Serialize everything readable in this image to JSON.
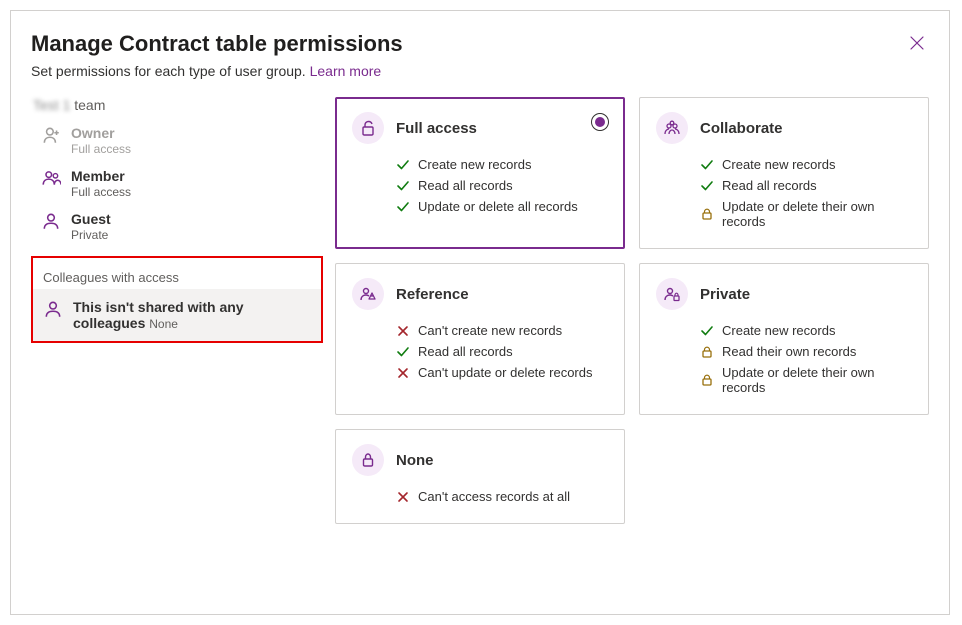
{
  "header": {
    "title": "Manage Contract table permissions",
    "subtitle_prefix": "Set permissions for each type of user group. ",
    "learn_more": "Learn more"
  },
  "sidebar": {
    "team_blurred": "Test 1",
    "team_suffix": " team",
    "roles": [
      {
        "name": "Owner",
        "sub": "Full access",
        "icon": "person-add",
        "disabled": true
      },
      {
        "name": "Member",
        "sub": "Full access",
        "icon": "people",
        "disabled": false
      },
      {
        "name": "Guest",
        "sub": "Private",
        "icon": "person",
        "disabled": false
      }
    ],
    "colleagues_label": "Colleagues with access",
    "colleague_row": {
      "title": "This isn't shared with any colleagues",
      "sub": "None"
    }
  },
  "cards": [
    {
      "key": "full-access",
      "title": "Full access",
      "icon": "unlock",
      "selected": true,
      "tall": true,
      "perms": [
        {
          "icon": "check",
          "text": "Create new records"
        },
        {
          "icon": "check",
          "text": "Read all records"
        },
        {
          "icon": "check",
          "text": "Update or delete all records"
        }
      ]
    },
    {
      "key": "collaborate",
      "title": "Collaborate",
      "icon": "group",
      "selected": false,
      "tall": true,
      "perms": [
        {
          "icon": "check",
          "text": "Create new records"
        },
        {
          "icon": "check",
          "text": "Read all records"
        },
        {
          "icon": "lock",
          "text": "Update or delete their own records"
        }
      ]
    },
    {
      "key": "reference",
      "title": "Reference",
      "icon": "person-warn",
      "selected": false,
      "tall": true,
      "perms": [
        {
          "icon": "x",
          "text": "Can't create new records"
        },
        {
          "icon": "check",
          "text": "Read all records"
        },
        {
          "icon": "x",
          "text": "Can't update or delete records"
        }
      ]
    },
    {
      "key": "private",
      "title": "Private",
      "icon": "private",
      "selected": false,
      "tall": true,
      "perms": [
        {
          "icon": "check",
          "text": "Create new records"
        },
        {
          "icon": "lock",
          "text": "Read their own records"
        },
        {
          "icon": "lock",
          "text": "Update or delete their own records"
        }
      ]
    },
    {
      "key": "none",
      "title": "None",
      "icon": "lock-closed",
      "selected": false,
      "tall": false,
      "perms": [
        {
          "icon": "x",
          "text": "Can't access records at all"
        }
      ]
    }
  ]
}
